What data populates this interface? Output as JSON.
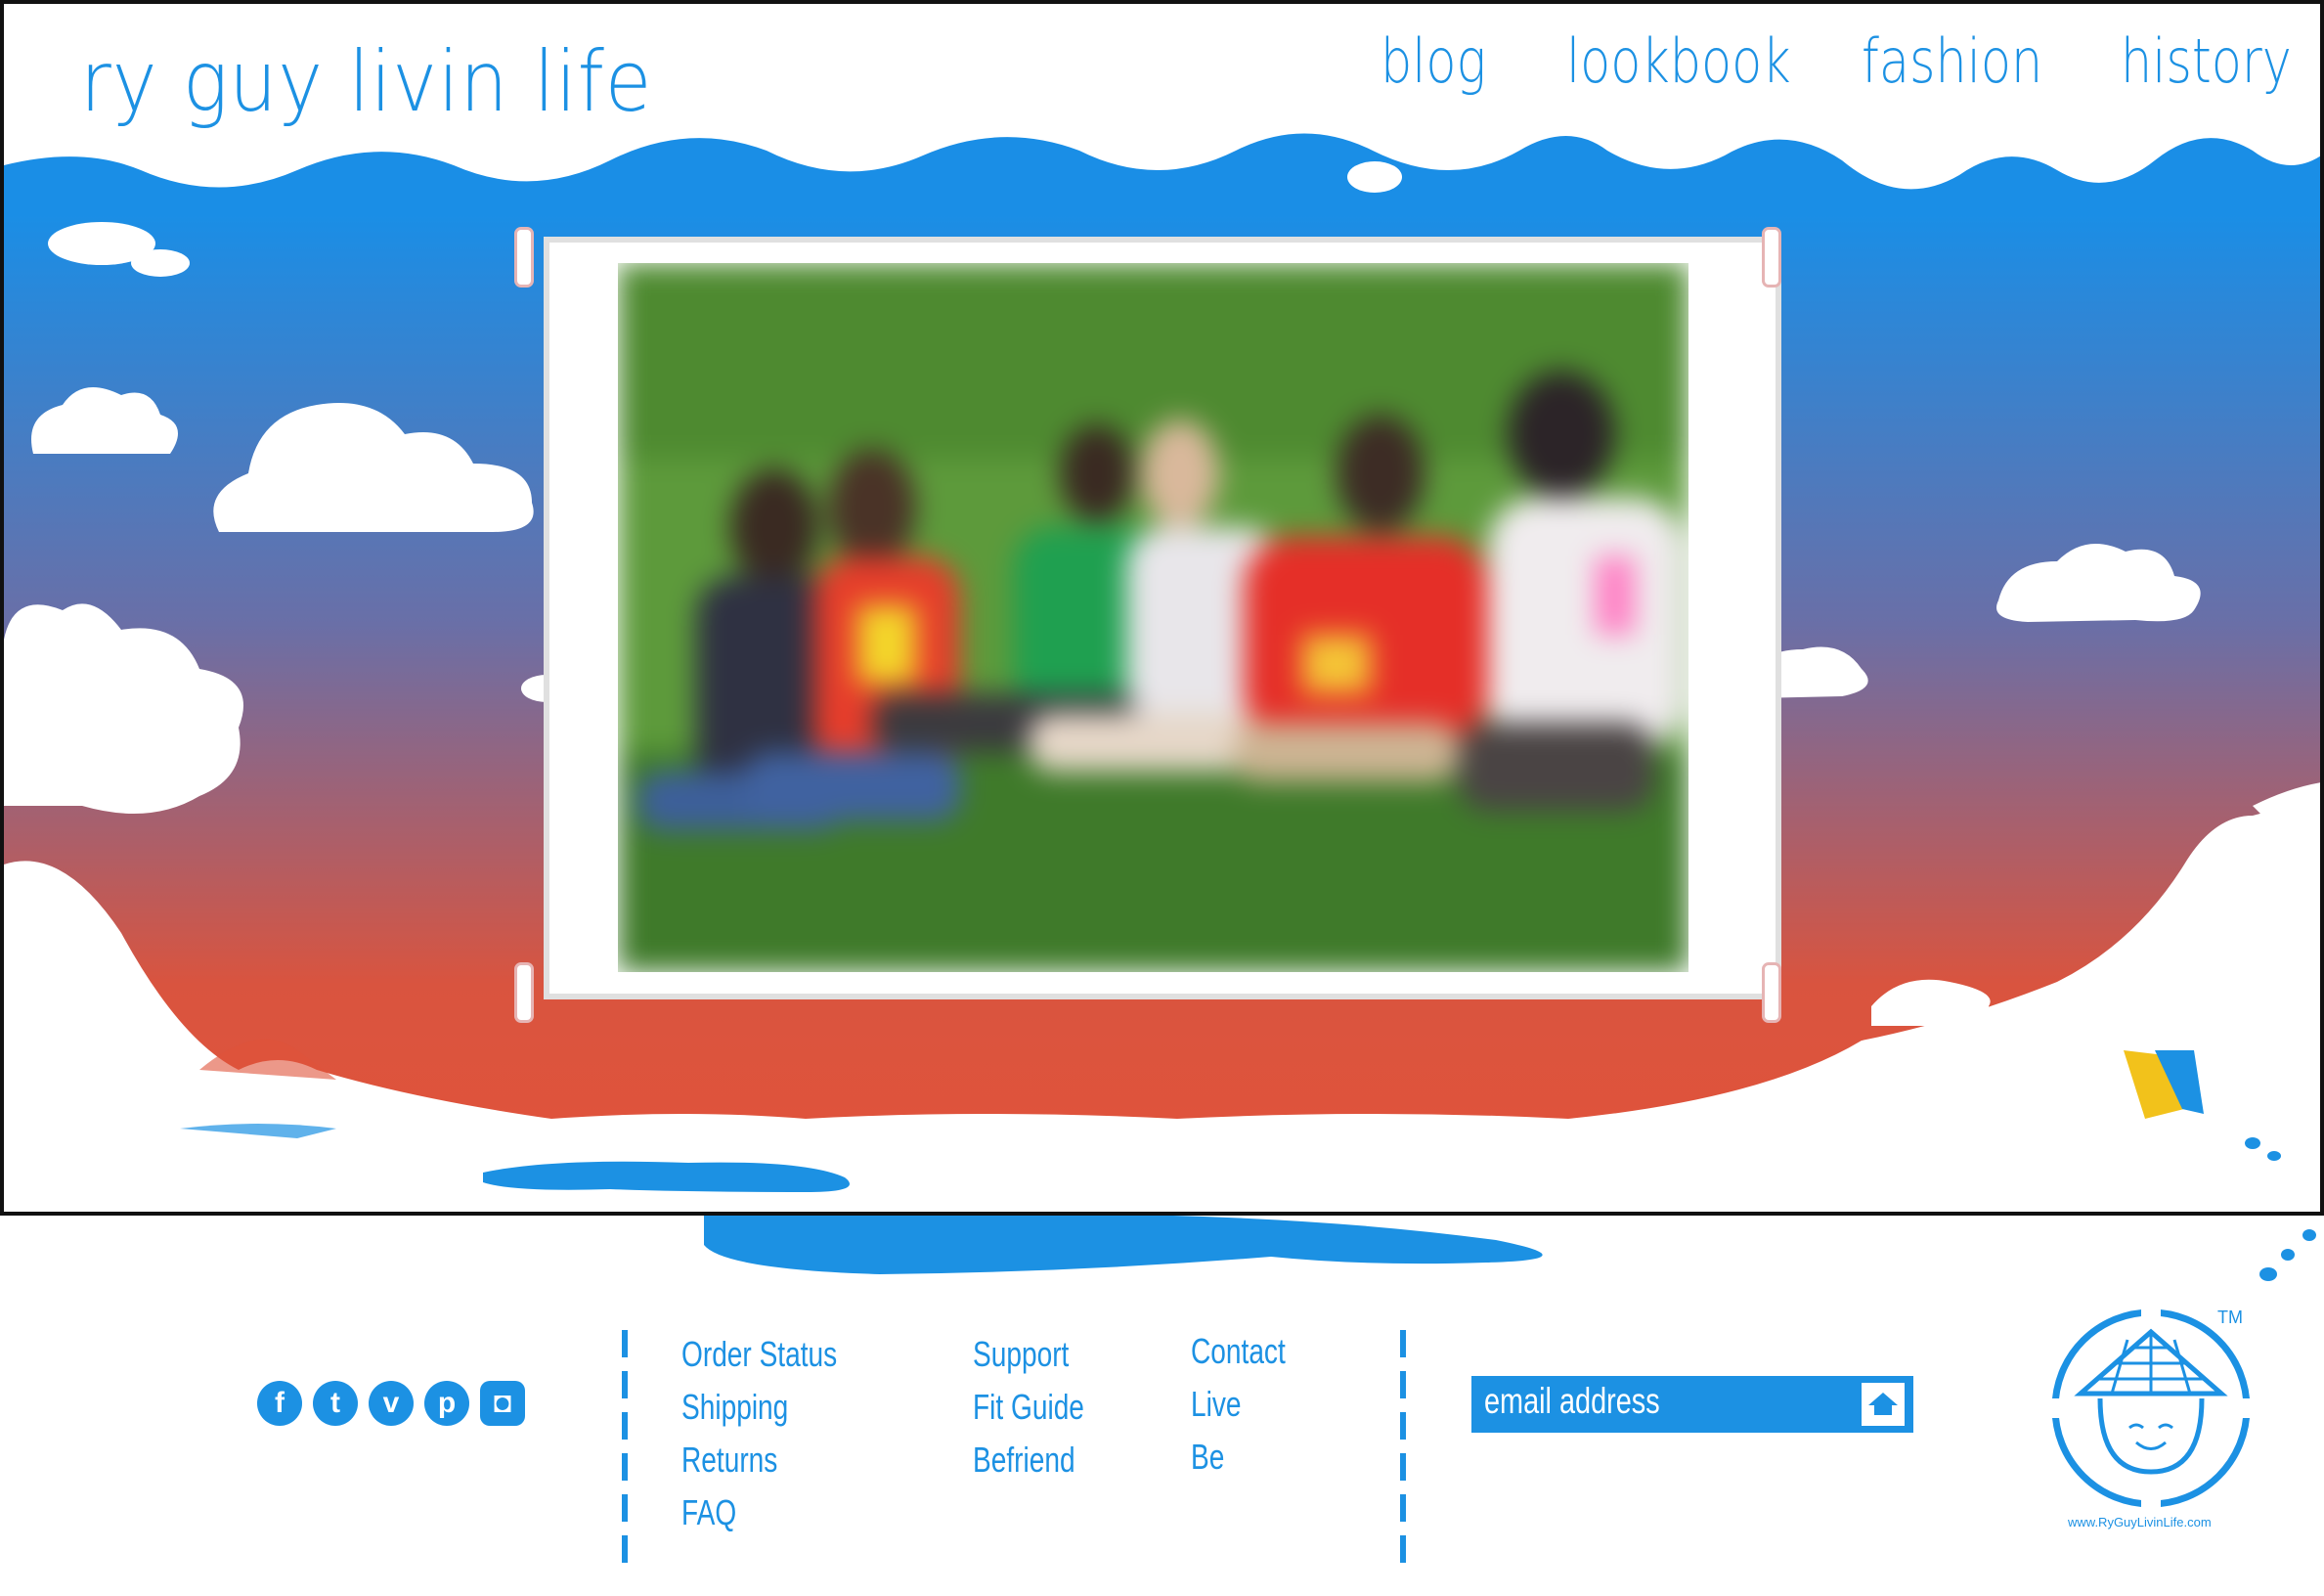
{
  "brand": {
    "title": "ry guy livin life"
  },
  "nav": [
    {
      "label": "blog"
    },
    {
      "label": "lookbook"
    },
    {
      "label": "fashion"
    },
    {
      "label": "history"
    }
  ],
  "social": [
    {
      "name": "facebook",
      "icon": "facebook-icon",
      "glyph": "f"
    },
    {
      "name": "twitter",
      "icon": "twitter-icon",
      "glyph": "t"
    },
    {
      "name": "vimeo",
      "icon": "vimeo-icon",
      "glyph": "v"
    },
    {
      "name": "pinterest",
      "icon": "pinterest-icon",
      "glyph": "p"
    },
    {
      "name": "instagram",
      "icon": "instagram-icon",
      "glyph": "◘"
    }
  ],
  "footer": {
    "col1": [
      "Order Status",
      "Shipping",
      "Returns",
      "FAQ"
    ],
    "col2": [
      "Support",
      "Fit Guide",
      "Befriend"
    ],
    "col3": [
      "Contact",
      "Live",
      "Be"
    ]
  },
  "newsletter": {
    "placeholder": "email address",
    "submit_icon": "hat-arrow-icon"
  },
  "badge": {
    "trademark": "TM",
    "url": "www.RyGuyLivinLife.com"
  },
  "colors": {
    "brand_blue": "#1c91e3",
    "sky_top": "#1a8ee6",
    "sky_bottom": "#e0533b",
    "white": "#ffffff"
  }
}
